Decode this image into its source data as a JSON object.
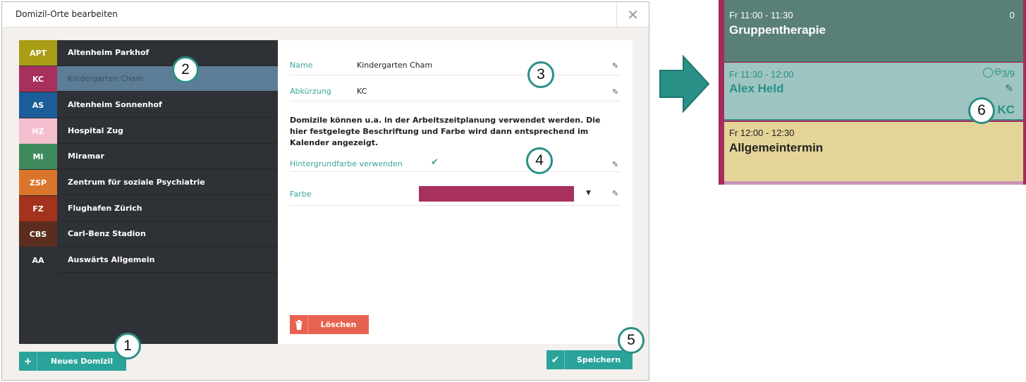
{
  "dialog": {
    "title": "Domizil-Orte bearbeiten",
    "close_glyph": "✕"
  },
  "domiciles": [
    {
      "abbr": "APT",
      "name": "Altenheim Parkhof",
      "color": "#a89d14"
    },
    {
      "abbr": "KC",
      "name": "Kindergarten Cham",
      "color": "#a8305d",
      "selected": true
    },
    {
      "abbr": "AS",
      "name": "Altenheim Sonnenhof",
      "color": "#1b5d98"
    },
    {
      "abbr": "HZ",
      "name": "Hospital Zug",
      "color": "#f4bfcf"
    },
    {
      "abbr": "MI",
      "name": "Miramar",
      "color": "#3f8a5c"
    },
    {
      "abbr": "ZSP",
      "name": "Zentrum für soziale Psychiatrie",
      "color": "#d9762b"
    },
    {
      "abbr": "FZ",
      "name": "Flughafen Zürich",
      "color": "#a4331d"
    },
    {
      "abbr": "CBS",
      "name": "Carl-Benz Stadion",
      "color": "#5a2d1e"
    },
    {
      "abbr": "AA",
      "name": "Auswärts Allgemein",
      "color": "#2e3136"
    }
  ],
  "form": {
    "name_label": "Name",
    "name_value": "Kindergarten Cham",
    "abbr_label": "Abkürzung",
    "abbr_value": "KC",
    "info": "Domizile können u.a. in der Arbeitszeitplanung verwendet werden. Die hier festgelegte Beschriftung und Farbe wird dann entsprechend im Kalender angezeigt.",
    "bg_label": "Hintergrundfarbe verwenden",
    "bg_checked": true,
    "color_label": "Farbe",
    "color_value": "#a8305d",
    "delete_label": "Löschen"
  },
  "footer": {
    "new_label": "Neues Domizil",
    "save_label": "Speichern"
  },
  "badges": [
    "1",
    "2",
    "3",
    "4",
    "5",
    "6"
  ],
  "calendar": {
    "slots": [
      {
        "time": "Fr 11:00 - 11:30",
        "title": "Gruppentherapie",
        "count": "0",
        "bg": "#5a7f79"
      },
      {
        "time": "Fr 11:30 - 12:00",
        "title": "Alex Held",
        "ratio": "3/9",
        "abbr": "KC",
        "bg": "#9ec5c1"
      },
      {
        "time": "Fr 12:00 - 12:30",
        "title": "Allgemeintermin",
        "bg": "#e4d498"
      }
    ]
  },
  "colors": {
    "accent": "#2aa39a",
    "danger": "#e8634f",
    "list_bg": "#2e3136",
    "selected": "#5d7d96"
  }
}
